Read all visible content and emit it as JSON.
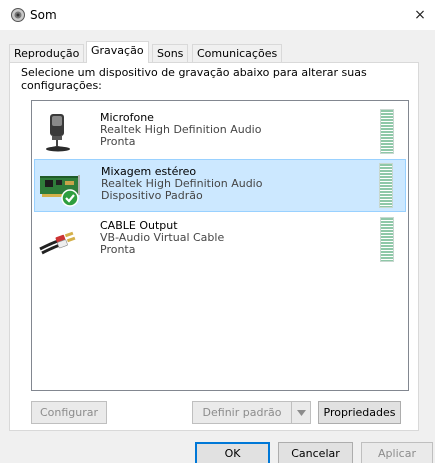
{
  "window": {
    "title": "Som",
    "close_glyph": "×"
  },
  "tabs": [
    {
      "label": "Reprodução",
      "active": false
    },
    {
      "label": "Gravação",
      "active": true
    },
    {
      "label": "Sons",
      "active": false
    },
    {
      "label": "Comunicações",
      "active": false
    }
  ],
  "instructions": "Selecione um dispositivo de gravação abaixo para alterar suas configurações:",
  "devices": [
    {
      "name": "Microfone",
      "driver": "Realtek High Definition Audio",
      "status": "Pronta",
      "icon": "microphone-icon",
      "selected": false
    },
    {
      "name": "Mixagem estéreo",
      "driver": "Realtek High Definition Audio",
      "status": "Dispositivo Padrão",
      "icon": "sound-card-icon",
      "selected": true
    },
    {
      "name": "CABLE Output",
      "driver": "VB-Audio Virtual Cable",
      "status": "Pronta",
      "icon": "rca-cable-icon",
      "selected": false
    }
  ],
  "buttons": {
    "configure": "Configurar",
    "set_default": "Definir padrão",
    "properties": "Propriedades",
    "ok": "OK",
    "cancel": "Cancelar",
    "apply": "Aplicar"
  },
  "colors": {
    "selection": "#cce8ff",
    "default_check": "#2e9e3e",
    "focus_border": "#0078d7"
  }
}
